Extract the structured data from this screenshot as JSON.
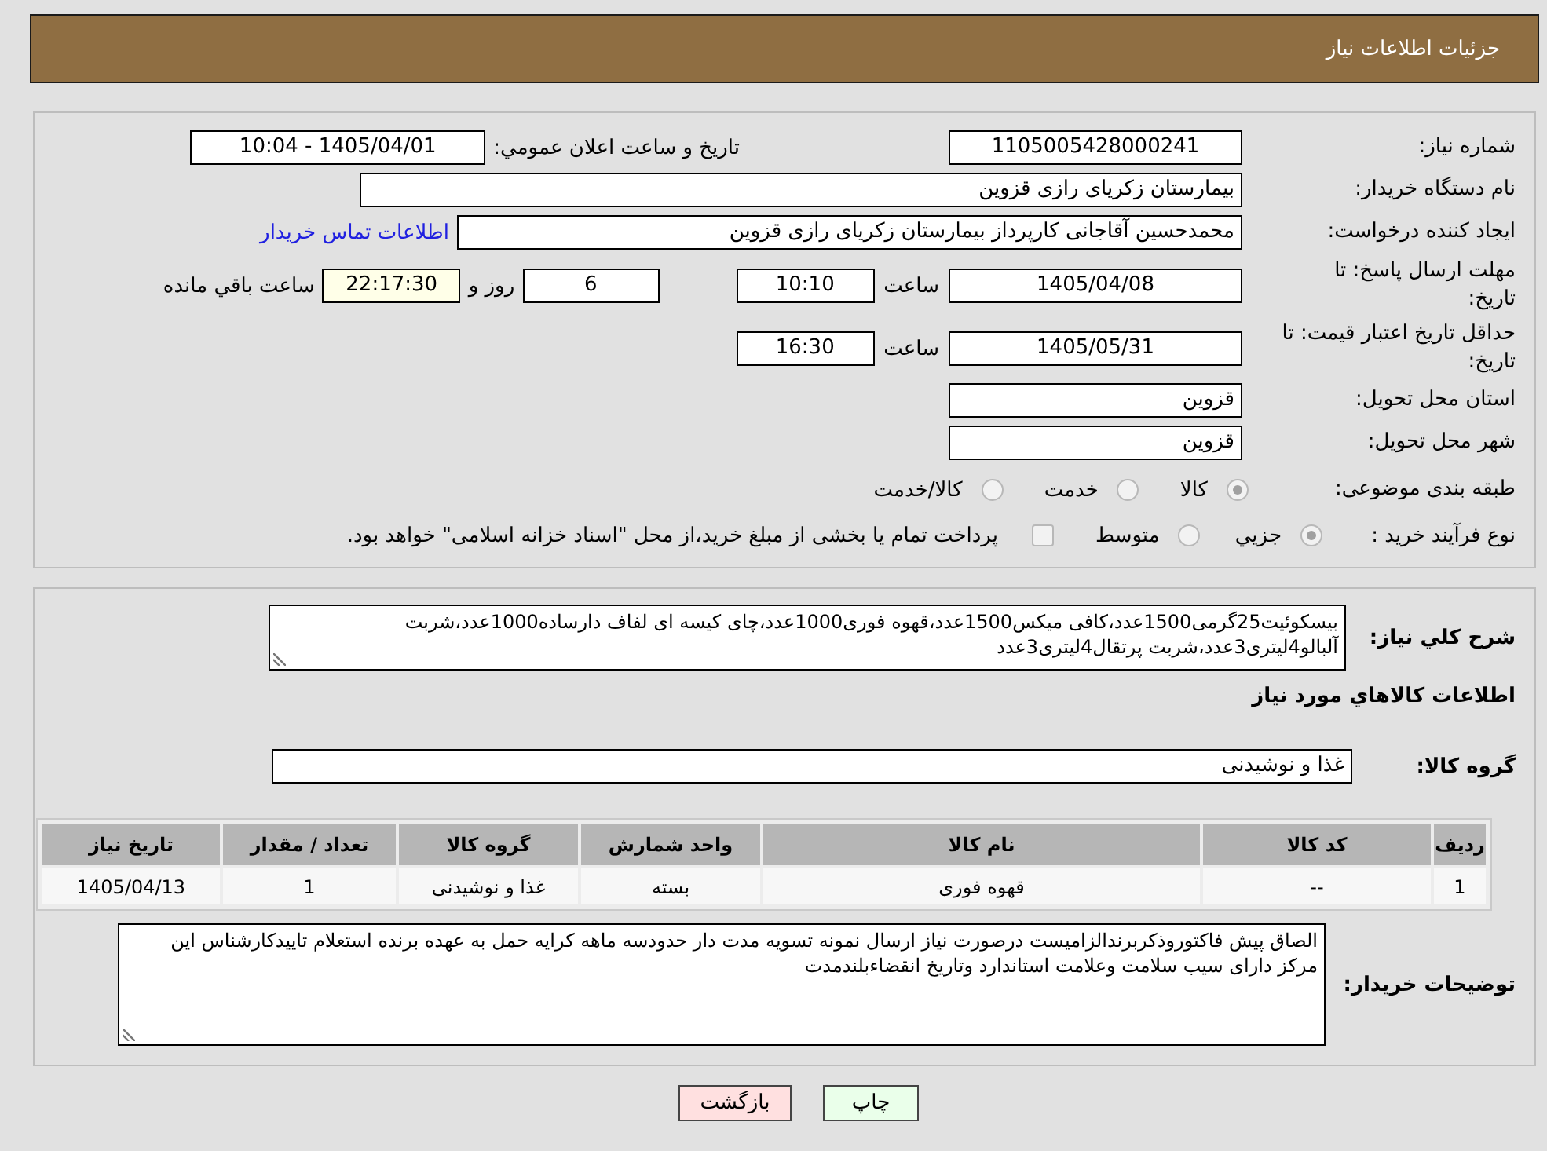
{
  "header": {
    "title": "جزئیات اطلاعات نیاز"
  },
  "details": {
    "need_number": {
      "label": "شماره نیاز:",
      "value": "1105005428000241"
    },
    "announce": {
      "label": "تاریخ و ساعت اعلان عمومي:",
      "value": "1405/04/01 - 10:04"
    },
    "buyer": {
      "label": "نام دستگاه خریدار:",
      "value": "بیمارستان زکریای رازی قزوین"
    },
    "requester": {
      "label": "ایجاد کننده درخواست:",
      "value": "محمدحسین آقاجانی کارپرداز بیمارستان زکریای رازی قزوین",
      "link": "اطلاعات تماس خریدار"
    },
    "response_deadline": {
      "label": "مهلت ارسال پاسخ: تا تاریخ:",
      "date": "1405/04/08",
      "time_label": "ساعت",
      "time": "10:10",
      "days": "6",
      "days_label": "روز و",
      "remaining": "22:17:30",
      "remaining_label": "ساعت باقي مانده"
    },
    "price_validity": {
      "label": "حداقل تاریخ اعتبار قیمت: تا تاریخ:",
      "date": "1405/05/31",
      "time_label": "ساعت",
      "time": "16:30"
    },
    "province": {
      "label": "استان محل تحویل:",
      "value": "قزوین"
    },
    "city": {
      "label": "شهر محل تحویل:",
      "value": "قزوین"
    },
    "category": {
      "label": "طبقه بندی موضوعی:",
      "options": [
        {
          "label": "کالا",
          "selected": true
        },
        {
          "label": "خدمت",
          "selected": false
        },
        {
          "label": "کالا/خدمت",
          "selected": false
        }
      ]
    },
    "process": {
      "label": "نوع فرآیند خرید :",
      "options": [
        {
          "label": "جزيي",
          "selected": true
        },
        {
          "label": "متوسط",
          "selected": false
        }
      ],
      "treasury": {
        "label": "پرداخت تمام یا بخشی از مبلغ خرید،از محل \"اسناد خزانه اسلامی\" خواهد بود.",
        "checked": false
      }
    }
  },
  "needs": {
    "description": {
      "label": "شرح كلي نياز:",
      "value": "بیسکوئیت25گرمی1500عدد،کافی میکس1500عدد،قهوه فوری1000عدد،چای کیسه ای لفاف دارساده1000عدد،شربت آلبالو4لیتری3عدد،شربت پرتقال4لیتری3عدد"
    },
    "goods_title": "اطلاعات كالاهاي مورد نياز",
    "group": {
      "label": "گروه كالا:",
      "value": "غذا و نوشیدنی"
    },
    "table": {
      "columns": [
        "ردیف",
        "کد کالا",
        "نام کالا",
        "واحد شمارش",
        "گروه کالا",
        "تعداد / مقدار",
        "تاریخ نیاز"
      ],
      "rows": [
        [
          "1",
          "--",
          "قهوه فوری",
          "بسته",
          "غذا و نوشیدنی",
          "1",
          "1405/04/13"
        ]
      ]
    },
    "buyer_notes": {
      "label": "توضیحات خریدار:",
      "value": "الصاق پیش فاکتوروذکربرندالزامیست درصورت نیاز ارسال نمونه تسویه مدت دار حدودسه ماهه کرایه حمل به عهده برنده استعلام تاییدکارشناس این مرکز دارای سیب سلامت وعلامت استاندارد وتاریخ انقضاءبلندمدت"
    }
  },
  "buttons": [
    {
      "label": "چاپ",
      "kind": "print"
    },
    {
      "label": "بازگشت",
      "kind": "back"
    }
  ]
}
